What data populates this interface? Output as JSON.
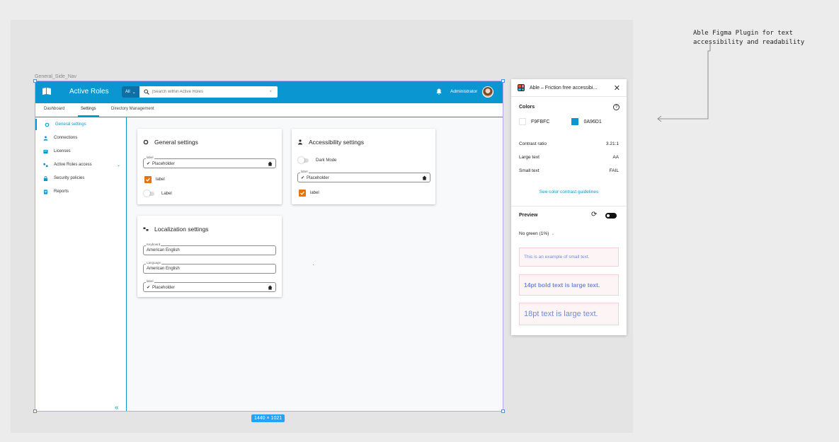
{
  "annotation": {
    "text": "Able Figma Plugin for text accessibility and readability"
  },
  "frame": {
    "label": "General_Side_Nav",
    "dimensions": "1440 × 1021"
  },
  "app": {
    "title": "Active Roles",
    "search": {
      "scope": "All",
      "placeholder": "|Search within Active Roles",
      "clear": "×"
    },
    "user": "Administrator"
  },
  "tabs": [
    "Dashboard",
    "Settings",
    "Directory Management"
  ],
  "sidebar": {
    "items": [
      {
        "label": "General settings",
        "icon": "gear-icon"
      },
      {
        "label": "Connections",
        "icon": "people-icon"
      },
      {
        "label": "Licenses",
        "icon": "license-icon"
      },
      {
        "label": "Active Roles access",
        "icon": "access-icon"
      },
      {
        "label": "Security policies",
        "icon": "lock-icon"
      },
      {
        "label": "Reports",
        "icon": "report-icon"
      }
    ],
    "collapse": "«"
  },
  "general_card": {
    "title": "General settings",
    "field": {
      "label": "label",
      "value": "Placeholder"
    },
    "checkbox_label": "label",
    "toggle_label": "Label"
  },
  "accessibility_card": {
    "title": "Accessibility settings",
    "toggle_label": "Dark Mode",
    "field": {
      "label": "label",
      "value": "Placeholder"
    },
    "checkbox_label": "label"
  },
  "localization_card": {
    "title": "Localization settings",
    "keyboard": {
      "label": "Keyboard",
      "value": "American English"
    },
    "language": {
      "label": "Language",
      "value": "American English"
    },
    "field": {
      "label": "label",
      "value": "Placeholder"
    }
  },
  "plugin": {
    "title": "Able – Friction free accessibi...",
    "colors_heading": "Colors",
    "help": "?",
    "color1": {
      "hex": "F9FBFC",
      "swatch": "#F9FBFC"
    },
    "color2": {
      "hex": "0A96D1",
      "swatch": "#0A96D1"
    },
    "contrast": {
      "label": "Contrast ratio",
      "value": "3.21:1"
    },
    "large_text": {
      "label": "Large text",
      "value": "AA"
    },
    "small_text": {
      "label": "Small text",
      "value": "FAIL"
    },
    "link": "See color contrast guidelines",
    "preview_heading": "Preview",
    "filter": "No green (1%)",
    "samples": [
      "This is an example of small text.",
      "14pt bold text is large text.",
      "18pt text is large text."
    ]
  },
  "colors": {
    "primary": "#0A96D1",
    "accent": "#E8720C",
    "background": "#F9FBFC"
  }
}
